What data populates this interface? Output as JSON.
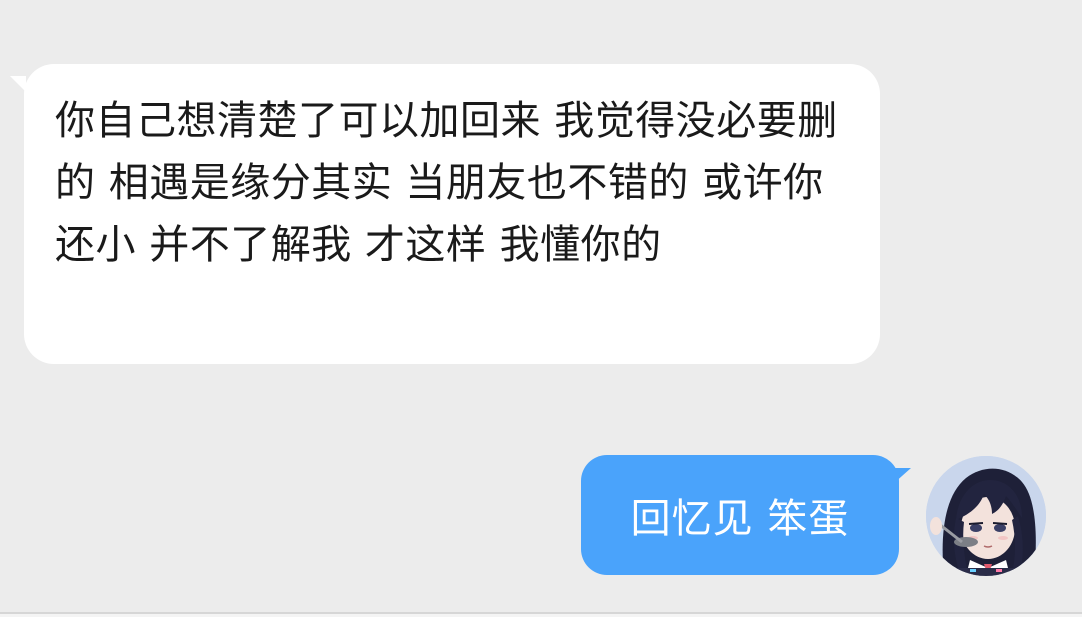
{
  "chat": {
    "messages": [
      {
        "direction": "incoming",
        "text": "你自己想清楚了可以加回来 我觉得没必要删的 相遇是缘分其实 当朋友也不错的 或许你还小 并不了解我 才这样 我懂你的"
      },
      {
        "direction": "outgoing",
        "text": "回忆见 笨蛋"
      }
    ]
  },
  "avatar": {
    "icon": "anime-girl-avatar-icon"
  },
  "colors": {
    "background": "#ececec",
    "incoming_bubble": "#ffffff",
    "outgoing_bubble": "#4aa3fb",
    "incoming_text": "#1a1a1a",
    "outgoing_text": "#ffffff"
  }
}
